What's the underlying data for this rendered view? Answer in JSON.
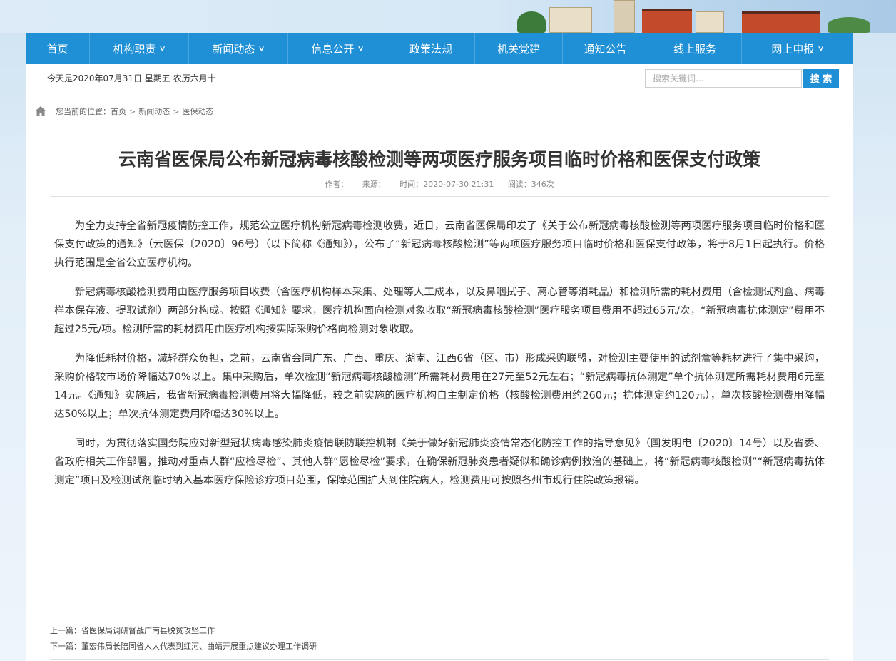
{
  "nav": {
    "items": [
      {
        "label": "首页",
        "dropdown": false
      },
      {
        "label": "机构职责",
        "dropdown": true
      },
      {
        "label": "新闻动态",
        "dropdown": true
      },
      {
        "label": "信息公开",
        "dropdown": true
      },
      {
        "label": "政策法规",
        "dropdown": false
      },
      {
        "label": "机关党建",
        "dropdown": false
      },
      {
        "label": "通知公告",
        "dropdown": false
      },
      {
        "label": "线上服务",
        "dropdown": false
      },
      {
        "label": "网上申报",
        "dropdown": true
      }
    ]
  },
  "infobar": {
    "date_text": "今天是2020年07月31日 星期五 农历六月十一",
    "search_placeholder": "搜索关键词...",
    "search_button": "搜 索"
  },
  "breadcrumb": {
    "prefix": "您当前的位置：",
    "items": [
      "首页",
      "新闻动态",
      "医保动态"
    ],
    "separator": ">"
  },
  "article": {
    "title": "云南省医保局公布新冠病毒核酸检测等两项医疗服务项目临时价格和医保支付政策",
    "meta": {
      "author": "作者：",
      "source": "来源：",
      "time": "时间：2020-07-30 21:31",
      "reads": "阅读：346次"
    },
    "paragraphs": [
      "为全力支持全省新冠疫情防控工作，规范公立医疗机构新冠病毒检测收费，近日，云南省医保局印发了《关于公布新冠病毒核酸检测等两项医疗服务项目临时价格和医保支付政策的通知》（云医保〔2020〕96号）（以下简称《通知》），公布了“新冠病毒核酸检测”等两项医疗服务项目临时价格和医保支付政策，将于8月1日起执行。价格执行范围是全省公立医疗机构。",
      "新冠病毒核酸检测费用由医疗服务项目收费（含医疗机构样本采集、处理等人工成本，以及鼻咽拭子、离心管等消耗品）和检测所需的耗材费用（含检测试剂盒、病毒样本保存液、提取试剂）两部分构成。按照《通知》要求，医疗机构面向检测对象收取“新冠病毒核酸检测”医疗服务项目费用不超过65元/次，“新冠病毒抗体测定”费用不超过25元/项。检测所需的耗材费用由医疗机构按实际采购价格向检测对象收取。",
      "为降低耗材价格，减轻群众负担，之前，云南省会同广东、广西、重庆、湖南、江西6省（区、市）形成采购联盟，对检测主要使用的试剂盒等耗材进行了集中采购，采购价格较市场价降幅达70%以上。集中采购后，单次检测“新冠病毒核酸检测”所需耗材费用在27元至52元左右；“新冠病毒抗体测定”单个抗体测定所需耗材费用6元至14元。《通知》实施后，我省新冠病毒检测费用将大幅降低，较之前实施的医疗机构自主制定价格（核酸检测费用约260元；抗体测定约120元），单次核酸检测费用降幅达50%以上；单次抗体测定费用降幅达30%以上。",
      "同时，为贯彻落实国务院应对新型冠状病毒感染肺炎疫情联防联控机制《关于做好新冠肺炎疫情常态化防控工作的指导意见》（国发明电〔2020〕14号）以及省委、省政府相关工作部署，推动对重点人群“应检尽检”、其他人群“愿检尽检”要求，在确保新冠肺炎患者疑似和确诊病例救治的基础上，将“新冠病毒核酸检测”“新冠病毒抗体测定”项目及检测试剂临时纳入基本医疗保险诊疗项目范围，保障范围扩大到住院病人，检测费用可按照各州市现行住院政策报销。"
    ]
  },
  "prevnext": {
    "prev": "上一篇：省医保局调研督战广南县脱贫攻坚工作",
    "next": "下一篇：董宏伟局长陪同省人大代表到红河、曲靖开展重点建议办理工作调研"
  },
  "colors": {
    "nav_bg": "#1f8fd6",
    "search_button_bg": "#1f8fd6",
    "title_text": "#333333"
  }
}
